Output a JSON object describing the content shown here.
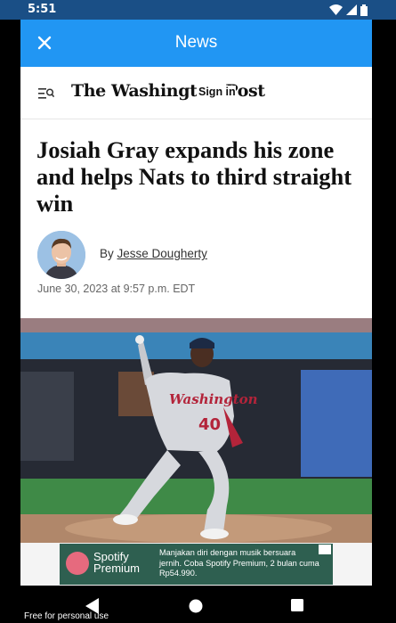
{
  "status_bar": {
    "time": "5:51"
  },
  "app_bar": {
    "title": "News"
  },
  "site_header": {
    "logo_text": "The Washington Post",
    "sign_in_label": "Sign in"
  },
  "article": {
    "headline": "Josiah Gray expands his zone and helps Nats to third straight win",
    "byline_prefix": "By",
    "author": "Jesse Dougherty",
    "date": "June 30, 2023 at 9:57 p.m. EDT"
  },
  "ad": {
    "brand_line1": "Spotify",
    "brand_line2": "Premium",
    "text": "Manjakan diri dengan musik bersuara jernih. Coba Spotify Premium, 2 bulan cuma Rp54.990."
  },
  "footer_note": "Free for personal use",
  "colors": {
    "app_bar": "#2196f3",
    "status_bar": "#1a4f86",
    "ad_bg": "#2e5f50"
  }
}
